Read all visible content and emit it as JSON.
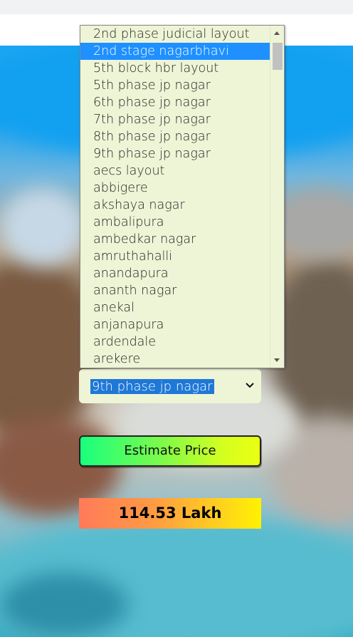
{
  "location_select": {
    "selected_value": "9th phase jp nagar",
    "options": [
      {
        "label": "2nd phase judicial layout",
        "highlighted": false
      },
      {
        "label": "2nd stage nagarbhavi",
        "highlighted": true
      },
      {
        "label": "5th block hbr layout",
        "highlighted": false
      },
      {
        "label": "5th phase jp nagar",
        "highlighted": false
      },
      {
        "label": "6th phase jp nagar",
        "highlighted": false
      },
      {
        "label": "7th phase jp nagar",
        "highlighted": false
      },
      {
        "label": "8th phase jp nagar",
        "highlighted": false
      },
      {
        "label": "9th phase jp nagar",
        "highlighted": false
      },
      {
        "label": "aecs layout",
        "highlighted": false
      },
      {
        "label": "abbigere",
        "highlighted": false
      },
      {
        "label": "akshaya nagar",
        "highlighted": false
      },
      {
        "label": "ambalipura",
        "highlighted": false
      },
      {
        "label": "ambedkar nagar",
        "highlighted": false
      },
      {
        "label": "amruthahalli",
        "highlighted": false
      },
      {
        "label": "anandapura",
        "highlighted": false
      },
      {
        "label": "ananth nagar",
        "highlighted": false
      },
      {
        "label": "anekal",
        "highlighted": false
      },
      {
        "label": "anjanapura",
        "highlighted": false
      },
      {
        "label": "ardendale",
        "highlighted": false
      },
      {
        "label": "arekere",
        "highlighted": false
      }
    ],
    "scroll_position": 0.05
  },
  "estimate_button": {
    "label": "Estimate Price"
  },
  "result": {
    "value": "114.53 Lakh"
  },
  "icons": {
    "select_chevron": "chevron-down-icon",
    "scroll_up": "scroll-up-icon",
    "scroll_down": "scroll-down-icon"
  },
  "colors": {
    "highlight": "#1e90ff",
    "panel_bg": "#eef5d6",
    "button_gradient_start": "#19ff7e",
    "button_gradient_end": "#eaff10",
    "result_gradient_start": "#ff7a5a",
    "result_gradient_end": "#fff200"
  }
}
